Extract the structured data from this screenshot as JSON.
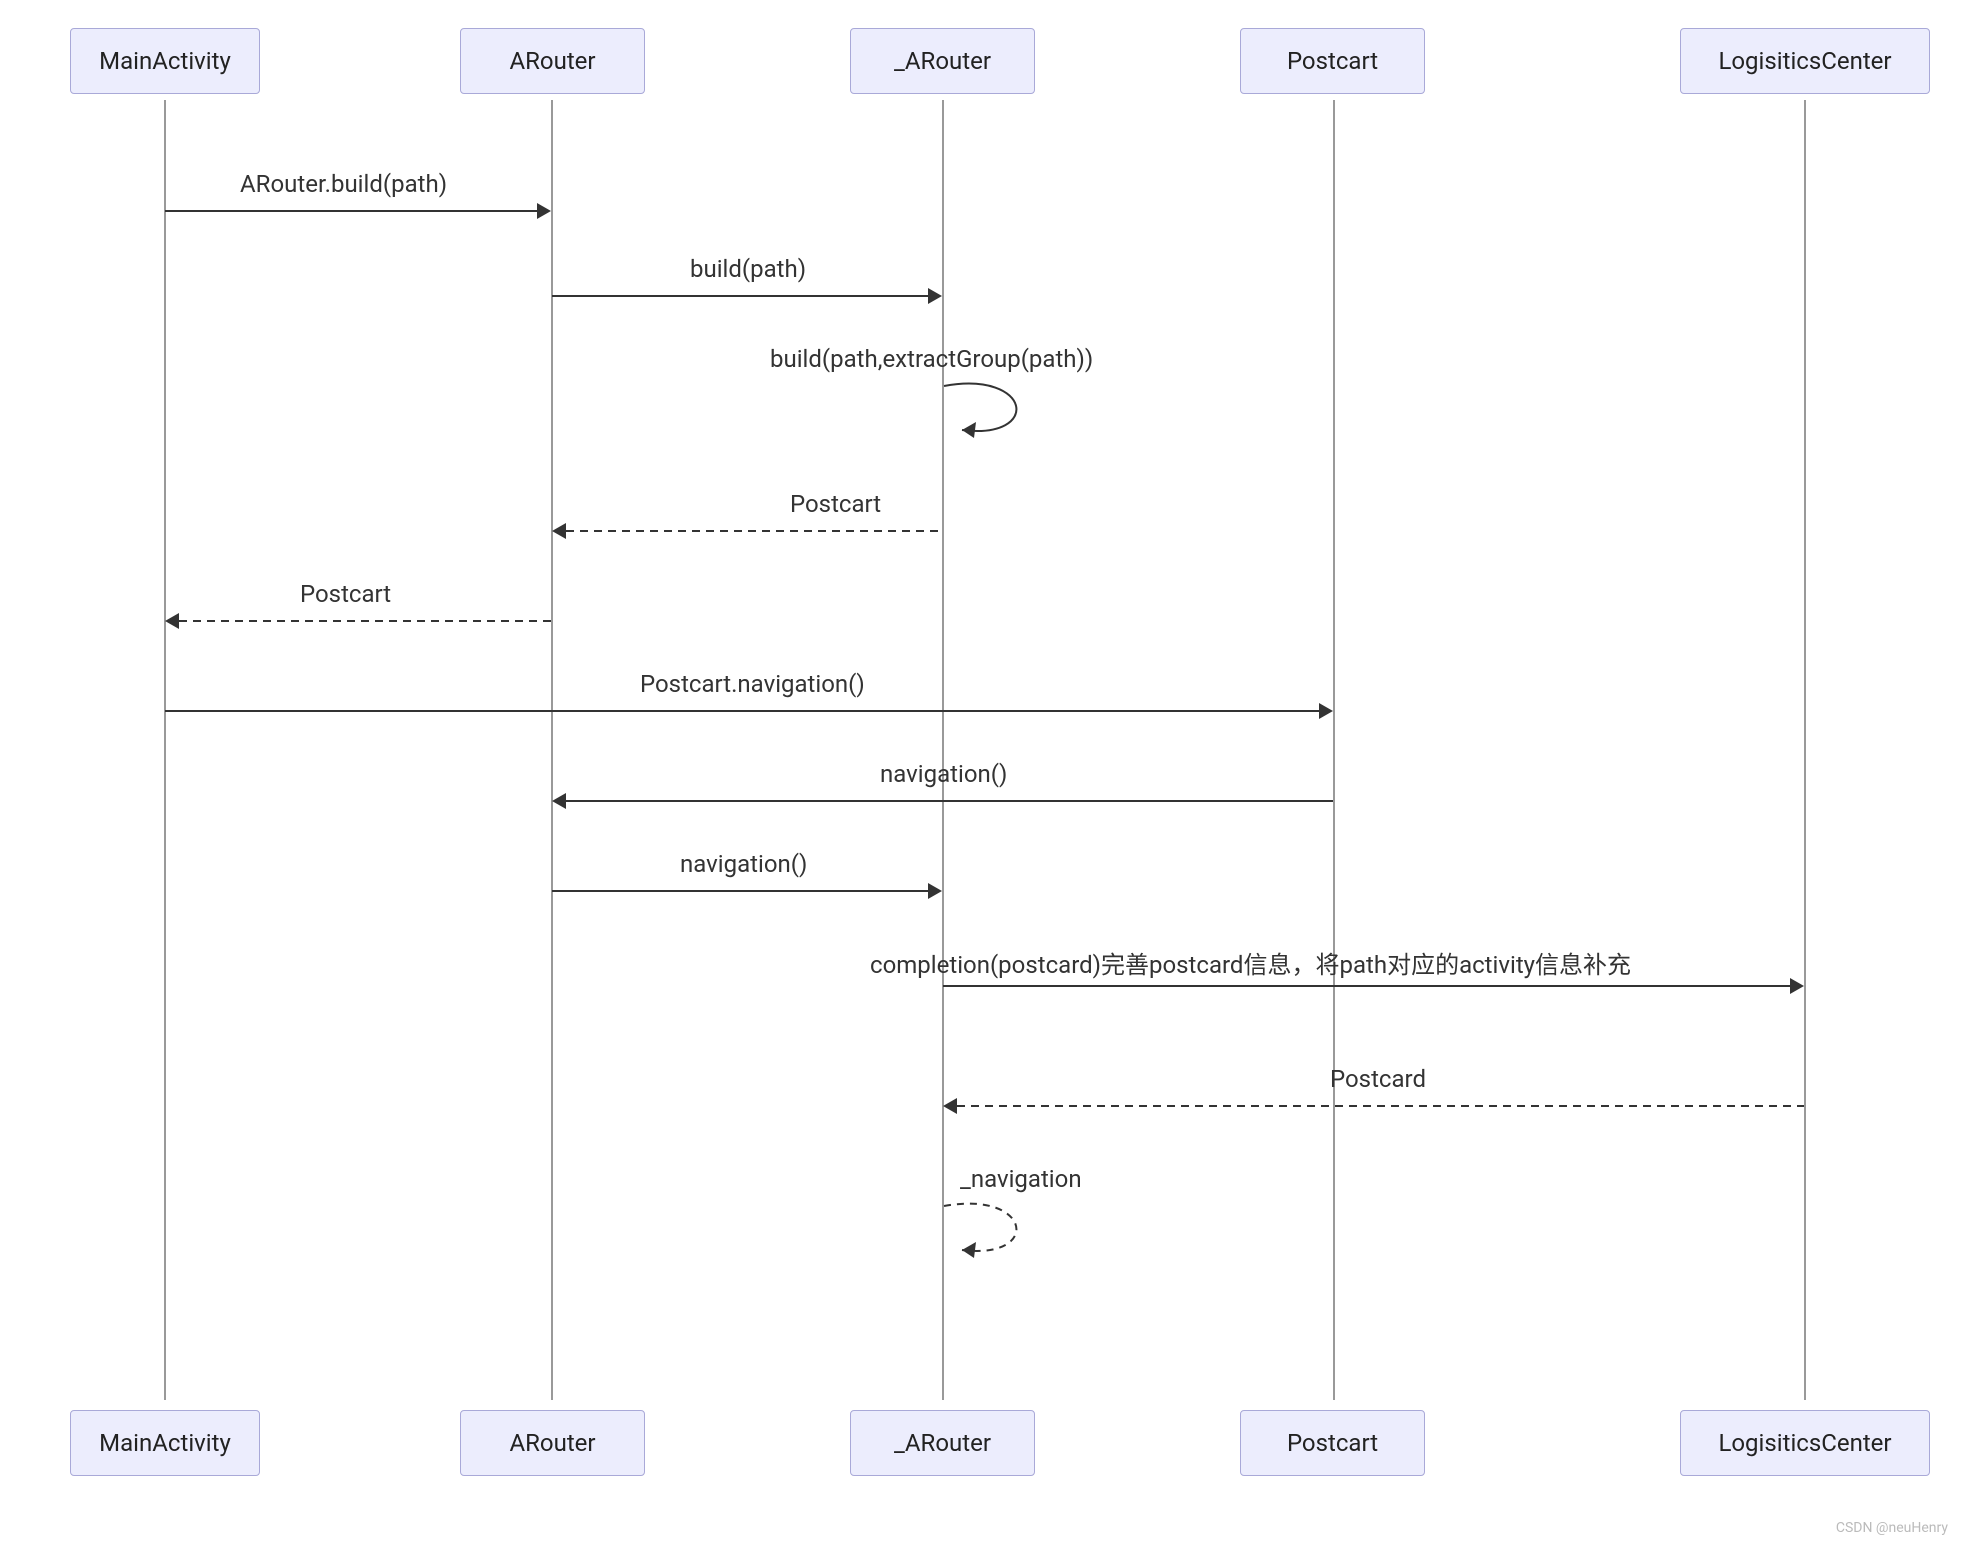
{
  "participants": [
    {
      "id": "p0",
      "name": "MainActivity"
    },
    {
      "id": "p1",
      "name": "ARouter"
    },
    {
      "id": "p2",
      "name": "_ARouter"
    },
    {
      "id": "p3",
      "name": "Postcart"
    },
    {
      "id": "p4",
      "name": "LogisiticsCenter"
    }
  ],
  "messages": {
    "m0": "ARouter.build(path)",
    "m1": "build(path)",
    "m2": "build(path,extractGroup(path))",
    "m3": "Postcart",
    "m4": "Postcart",
    "m5": "Postcart.navigation()",
    "m6": "navigation()",
    "m7": "navigation()",
    "m8": "completion(postcard)完善postcard信息，将path对应的activity信息补充",
    "m9": "Postcard",
    "m10": "_navigation"
  },
  "watermark": "CSDN @neuHenry",
  "chart_data": {
    "type": "sequence-diagram",
    "participants": [
      "MainActivity",
      "ARouter",
      "_ARouter",
      "Postcart",
      "LogisiticsCenter"
    ],
    "interactions": [
      {
        "from": "MainActivity",
        "to": "ARouter",
        "label": "ARouter.build(path)",
        "style": "solid"
      },
      {
        "from": "ARouter",
        "to": "_ARouter",
        "label": "build(path)",
        "style": "solid"
      },
      {
        "from": "_ARouter",
        "to": "_ARouter",
        "label": "build(path,extractGroup(path))",
        "style": "solid-self"
      },
      {
        "from": "_ARouter",
        "to": "ARouter",
        "label": "Postcart",
        "style": "dashed-return"
      },
      {
        "from": "ARouter",
        "to": "MainActivity",
        "label": "Postcart",
        "style": "dashed-return"
      },
      {
        "from": "MainActivity",
        "to": "Postcart",
        "label": "Postcart.navigation()",
        "style": "solid"
      },
      {
        "from": "Postcart",
        "to": "ARouter",
        "label": "navigation()",
        "style": "solid"
      },
      {
        "from": "ARouter",
        "to": "_ARouter",
        "label": "navigation()",
        "style": "solid"
      },
      {
        "from": "_ARouter",
        "to": "LogisiticsCenter",
        "label": "completion(postcard)完善postcard信息，将path对应的activity信息补充",
        "style": "solid"
      },
      {
        "from": "LogisiticsCenter",
        "to": "_ARouter",
        "label": "Postcard",
        "style": "dashed-return"
      },
      {
        "from": "_ARouter",
        "to": "_ARouter",
        "label": "_navigation",
        "style": "dashed-self"
      }
    ]
  }
}
